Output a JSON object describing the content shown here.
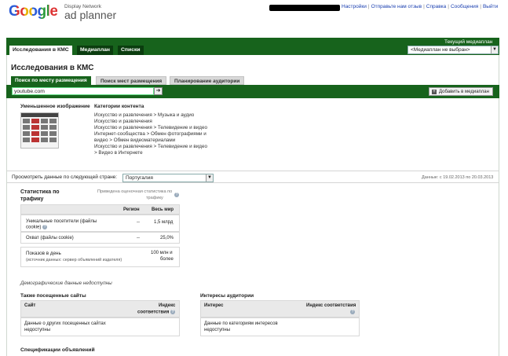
{
  "header": {
    "logo_google": "Google",
    "logo_sub1": "Display Network",
    "logo_sub2": "ad planner",
    "links": [
      "Настройки",
      "Отправьте нам отзыв",
      "Справка",
      "Сообщения",
      "Выйти"
    ]
  },
  "nav": {
    "tabs": [
      "Исследования в КМС",
      "Медиаплан",
      "Списки"
    ],
    "current_plan_label": "Текущий медиаплан",
    "current_plan_value": "<Медиаплан не выбран>"
  },
  "page": {
    "title": "Исследования в КМС",
    "subtabs": [
      "Поиск по месту размещения",
      "Поиск мест размещения",
      "Планирование аудитории"
    ],
    "search_value": "youtube.com",
    "add_button": "Добавить в медиаплан"
  },
  "summary": {
    "thumb_header": "Уменьшенное изображение",
    "categories_header": "Категории контента",
    "categories": [
      "Искусство и развлечения > Музыка и аудио",
      "Искусство и развлечения",
      "Искусство и развлечения > Телевидение и видео",
      "Интернет-сообщества > Обмен фотографиями и",
      "видео > Обмен видеоматериалами",
      "Искусство и развлечения > Телевидение и видео",
      "> Видео в Интернете"
    ]
  },
  "country": {
    "label": "Просмотреть данные по следующей стране:",
    "value": "Португалия",
    "date_range": "Данные: с 19.02.2013 по 20.03.2013"
  },
  "traffic": {
    "title_line1": "Статистика по",
    "title_line2": "трафику",
    "note_line1": "Приведена оценочная статистика по",
    "note_line2": "трафику",
    "col_region": "Регион",
    "col_world": "Весь мир",
    "rows": [
      {
        "label_line1": "Уникальные посетители (файлы",
        "label_line2": "cookie)",
        "region": "--",
        "world": "1,5 млрд"
      },
      {
        "label_line1": "Охват (файлы cookie)",
        "label_line2": "",
        "region": "--",
        "world": "25,0%"
      }
    ],
    "impressions_label": "Показов в день",
    "impressions_source": "(источник данных: сервер объявлений издателя)",
    "impressions_value_line1": "100 млн и",
    "impressions_value_line2": "более"
  },
  "demographics_note": "Демографические данные недоступны",
  "also_visited": {
    "title": "Также посещенные сайты",
    "col_site": "Сайт",
    "col_index_line1": "Индекс",
    "col_index_line2": "соответствия",
    "empty_line1": "Данные о других посещенных сайтах",
    "empty_line2": "недоступны"
  },
  "interests": {
    "title": "Интересы аудитории",
    "col_interest": "Интерес",
    "col_index": "Индекс соответствия",
    "empty_line1": "Данные по категориям интересов",
    "empty_line2": "недоступны"
  },
  "ad_specs_title": "Спецификации объявлений"
}
